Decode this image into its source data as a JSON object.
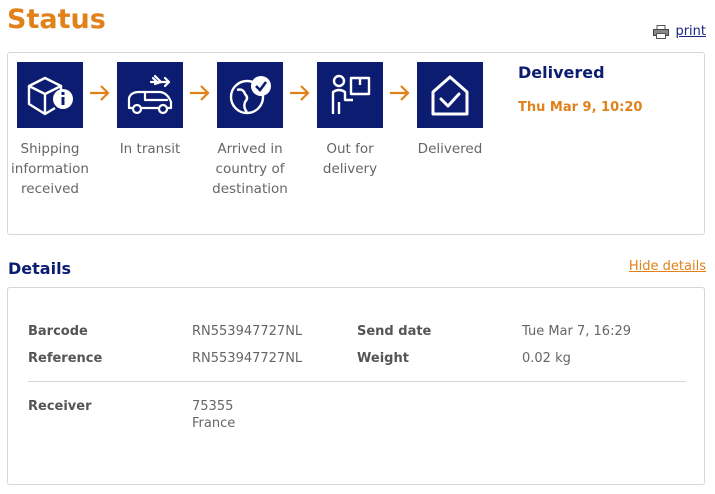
{
  "header": {
    "title": "Status",
    "print_label": "print"
  },
  "steps": [
    {
      "label": "Shipping information received",
      "icon": "box-info-icon"
    },
    {
      "label": "In transit",
      "icon": "plane-van-icon"
    },
    {
      "label": "Arrived in country of destination",
      "icon": "globe-check-icon"
    },
    {
      "label": "Out for delivery",
      "icon": "courier-icon"
    },
    {
      "label": "Delivered",
      "icon": "house-check-icon"
    }
  ],
  "current_status": {
    "title": "Delivered",
    "timestamp": "Thu Mar 9, 10:20"
  },
  "details": {
    "title": "Details",
    "hide_label": "Hide details",
    "barcode_label": "Barcode",
    "barcode_value": "RN553947727NL",
    "reference_label": "Reference",
    "reference_value": "RN553947727NL",
    "send_date_label": "Send date",
    "send_date_value": "Tue Mar 7, 16:29",
    "weight_label": "Weight",
    "weight_value": "0.02 kg",
    "receiver_label": "Receiver",
    "receiver_line1": "75355",
    "receiver_line2": "France"
  },
  "colors": {
    "accent": "#e0811a",
    "brand": "#0c1c70",
    "border": "#d6d6d6"
  }
}
